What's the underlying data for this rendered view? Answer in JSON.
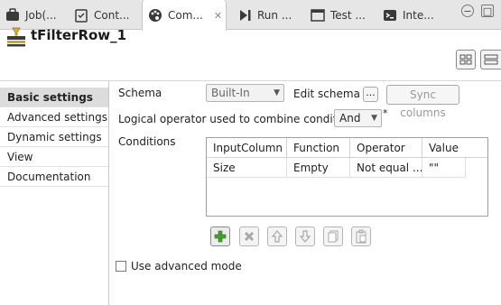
{
  "tabs": [
    {
      "label": "Job(...",
      "icon": "job-icon"
    },
    {
      "label": "Cont...",
      "icon": "clipboard-icon"
    },
    {
      "label": "Com...",
      "icon": "palette-icon",
      "active": true
    },
    {
      "label": "Run ...",
      "icon": "run-icon"
    },
    {
      "label": "Test ...",
      "icon": "window-icon"
    },
    {
      "label": "Inte...",
      "icon": "terminal-icon"
    }
  ],
  "window_controls": {
    "minimize": "−",
    "maximize": "□"
  },
  "component": {
    "title": "tFilterRow_1",
    "icon": "filter-row-icon"
  },
  "sidebar": {
    "items": [
      {
        "label": "Basic settings",
        "active": true
      },
      {
        "label": "Advanced settings"
      },
      {
        "label": "Dynamic settings"
      },
      {
        "label": "View"
      },
      {
        "label": "Documentation"
      }
    ]
  },
  "form": {
    "schema_label": "Schema",
    "schema_value": "Built-In",
    "edit_schema_label": "Edit schema",
    "edit_schema_button": "...",
    "sync_columns_label": "Sync columns",
    "logical_operator_label": "Logical operator used to combine conditions",
    "logical_operator_value": "And",
    "required_marker": "*",
    "conditions_label": "Conditions",
    "use_advanced_mode_label": "Use advanced mode"
  },
  "conditions_table": {
    "headers": [
      "InputColumn",
      "Function",
      "Operator",
      "Value"
    ],
    "rows": [
      [
        "Size",
        "Empty",
        "Not equal ...",
        "\"\""
      ]
    ]
  },
  "colors": {
    "accent_active_tab": "#ffffff",
    "add_icon": "#4aa02c",
    "sidebar_active": "#dcdcdc"
  }
}
